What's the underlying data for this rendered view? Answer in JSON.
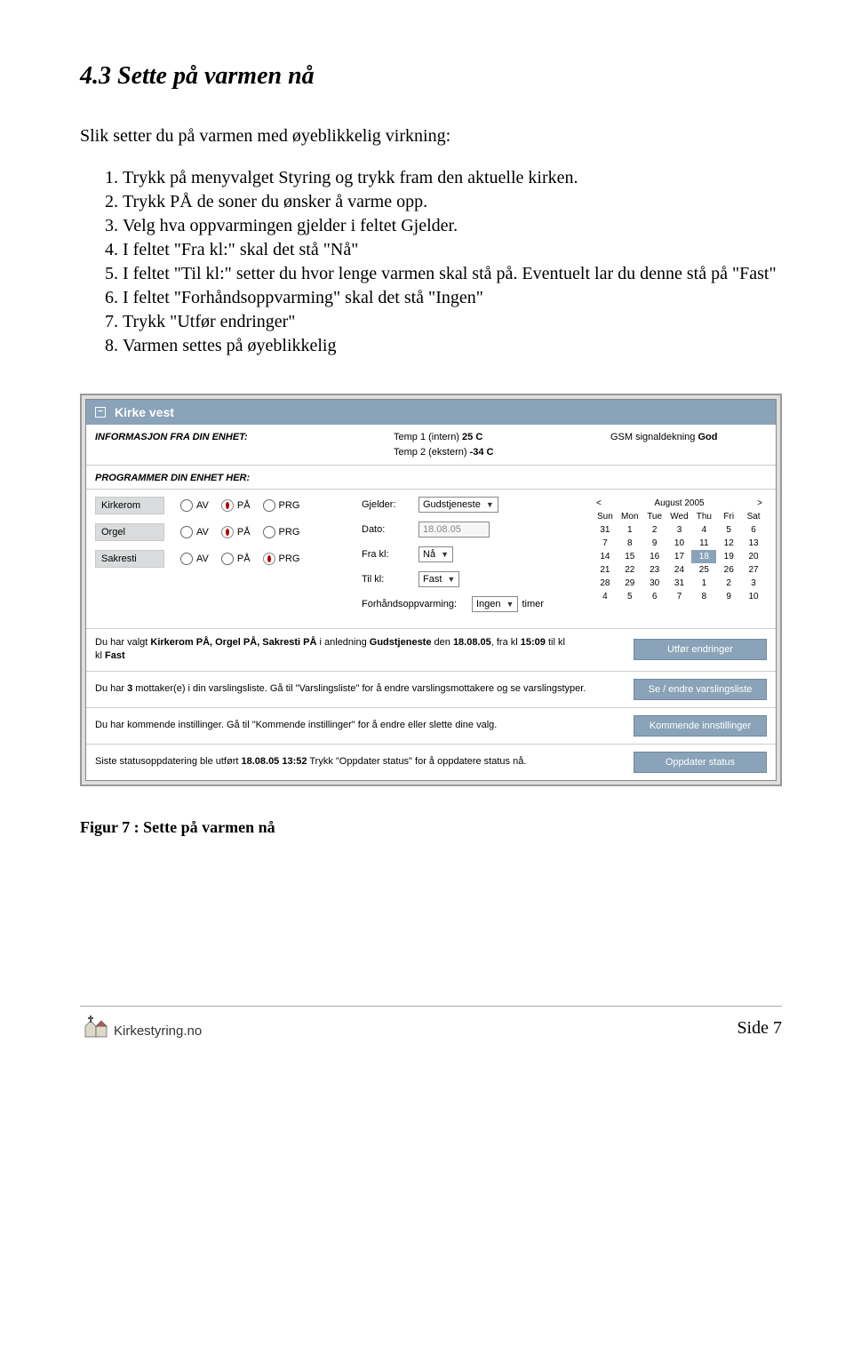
{
  "heading": "4.3  Sette på varmen nå",
  "intro": "Slik setter du på varmen med øyeblikkelig virkning:",
  "steps": [
    "Trykk på menyvalget Styring og trykk fram den aktuelle kirken.",
    "Trykk PÅ de soner du ønsker å varme opp.",
    "Velg hva oppvarmingen gjelder i feltet Gjelder.",
    "I feltet \"Fra kl:\" skal det stå \"Nå\"",
    "I feltet \"Til kl:\" setter du hvor lenge varmen skal stå på. Eventuelt lar du denne stå på \"Fast\"",
    "I feltet \"Forhåndsoppvarming\" skal det stå \"Ingen\"",
    "Trykk \"Utfør endringer\"",
    "Varmen settes på øyeblikkelig"
  ],
  "ui": {
    "title": "Kirke vest",
    "info_label": "INFORMASJON FRA DIN ENHET:",
    "temp1_label": "Temp 1 (intern)",
    "temp1_value": "25 C",
    "temp2_label": "Temp 2 (ekstern)",
    "temp2_value": "-34 C",
    "gsm_label": "GSM signaldekning",
    "gsm_value": "God",
    "prog_label": "PROGRAMMER DIN ENHET HER:",
    "rooms": [
      {
        "name": "Kirkerom",
        "state": "PÅ"
      },
      {
        "name": "Orgel",
        "state": "PÅ"
      },
      {
        "name": "Sakresti",
        "state": "PRG"
      }
    ],
    "radio_labels": {
      "av": "AV",
      "pa": "PÅ",
      "prg": "PRG"
    },
    "gjelder_label": "Gjelder:",
    "gjelder_value": "Gudstjeneste",
    "dato_label": "Dato:",
    "dato_value": "18.08.05",
    "frakl_label": "Fra kl:",
    "frakl_value": "Nå",
    "tilkl_label": "Til kl:",
    "tilkl_value": "Fast",
    "forhand_label": "Forhåndsoppvarming:",
    "forhand_value": "Ingen",
    "forhand_suffix": "timer",
    "cal": {
      "month": "August 2005",
      "dow": [
        "Sun",
        "Mon",
        "Tue",
        "Wed",
        "Thu",
        "Fri",
        "Sat"
      ],
      "days": [
        "31",
        "1",
        "2",
        "3",
        "4",
        "5",
        "6",
        "7",
        "8",
        "9",
        "10",
        "11",
        "12",
        "13",
        "14",
        "15",
        "16",
        "17",
        "18",
        "19",
        "20",
        "21",
        "22",
        "23",
        "24",
        "25",
        "26",
        "27",
        "28",
        "29",
        "30",
        "31",
        "1",
        "2",
        "3",
        "4",
        "5",
        "6",
        "7",
        "8",
        "9",
        "10"
      ],
      "selected_index": 18
    },
    "summary_prefix": "Du har valgt ",
    "summary_bold": "Kirkerom PÅ, Orgel PÅ, Sakresti PÅ",
    "summary_mid1": " i anledning ",
    "summary_bold2": "Gudstjeneste",
    "summary_mid2": " den ",
    "summary_bold3": "18.08.05",
    "summary_mid3": ", fra kl ",
    "summary_bold4": "15:09",
    "summary_mid4": " til kl ",
    "summary_bold5": "Fast",
    "btn_utfor": "Utfør endringer",
    "varsling_prefix": "Du har ",
    "varsling_bold": "3",
    "varsling_suffix": " mottaker(e) i din varslingsliste. Gå til \"Varslingsliste\" for å endre varslingsmottakere og se varslingstyper.",
    "btn_varsling": "Se / endre varslingsliste",
    "kommende_text": "Du har kommende instillinger. Gå til \"Kommende instillinger\" for å endre eller slette dine valg.",
    "btn_kommende": "Kommende innstillinger",
    "status_prefix": "Siste statusoppdatering ble utført ",
    "status_bold": "18.08.05 13:52",
    "status_suffix": " Trykk \"Oppdater status\" for å oppdatere status nå.",
    "btn_status": "Oppdater status"
  },
  "caption": "Figur 7 : Sette på varmen nå",
  "footer": {
    "brand": "Kirkestyring.no",
    "page": "Side 7"
  }
}
